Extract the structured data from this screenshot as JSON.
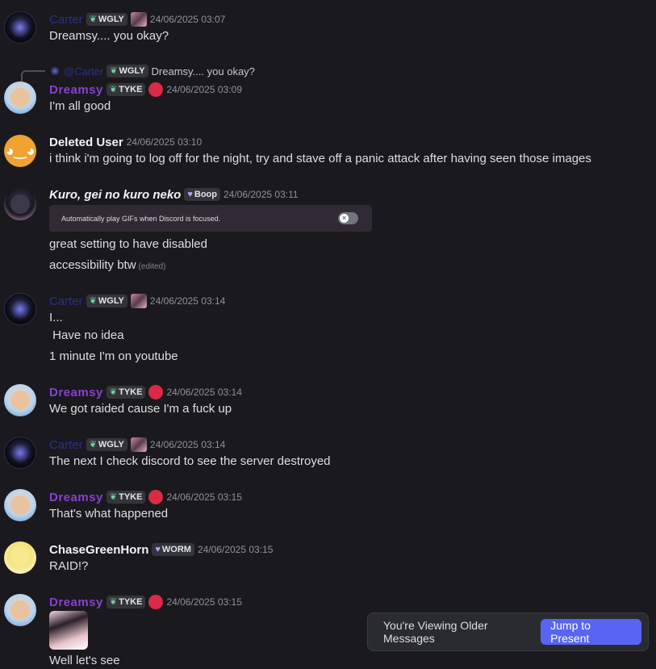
{
  "messages": [
    {
      "author": "Carter",
      "tag": "WGLY",
      "timestamp": "24/06/2025 03:07",
      "lines": [
        "Dreamsy.... you okay?"
      ]
    },
    {
      "reply": {
        "author": "@Carter",
        "tag": "WGLY",
        "text": "Dreamsy.... you okay?"
      },
      "author": "Dreamsy",
      "tag": "TYKE",
      "timestamp": "24/06/2025 03:09",
      "lines": [
        "I'm all good"
      ]
    },
    {
      "author": "Deleted User",
      "timestamp": "24/06/2025 03:10",
      "lines": [
        "i think i'm going to log off for the night, try and stave off a panic attack after having seen those images"
      ]
    },
    {
      "author": "Kuro, gei no kuro neko",
      "tag": "Boop",
      "timestamp": "24/06/2025 03:11",
      "embed_text": "Automatically play GIFs when Discord is focused.",
      "lines": [
        "great setting to have disabled",
        "accessibility btw"
      ],
      "edited": "(edited)"
    },
    {
      "author": "Carter",
      "tag": "WGLY",
      "timestamp": "24/06/2025 03:14",
      "lines": [
        "I...",
        " Have no idea",
        "1 minute I'm on youtube"
      ]
    },
    {
      "author": "Dreamsy",
      "tag": "TYKE",
      "timestamp": "24/06/2025 03:14",
      "lines": [
        "We got raided cause I'm a fuck up"
      ]
    },
    {
      "author": "Carter",
      "tag": "WGLY",
      "timestamp": "24/06/2025 03:14",
      "lines": [
        "The next I check discord to see the server destroyed"
      ]
    },
    {
      "author": "Dreamsy",
      "tag": "TYKE",
      "timestamp": "24/06/2025 03:15",
      "lines": [
        "That's what happened"
      ]
    },
    {
      "author": "ChaseGreenHorn",
      "tag": "WORM",
      "timestamp": "24/06/2025 03:15",
      "lines": [
        "RAID!?"
      ]
    },
    {
      "author": "Dreamsy",
      "tag": "TYKE",
      "timestamp": "24/06/2025 03:15",
      "lines": [
        "Well let's see"
      ]
    }
  ],
  "jump_bar": {
    "label": "You're Viewing Older Messages",
    "button": "Jump to Present"
  },
  "colors": {
    "background": "#1a1a1e",
    "accent": "#5865f2",
    "dreamsy_name": "#8a3fd0",
    "carter_name": "#2c2d8c"
  }
}
